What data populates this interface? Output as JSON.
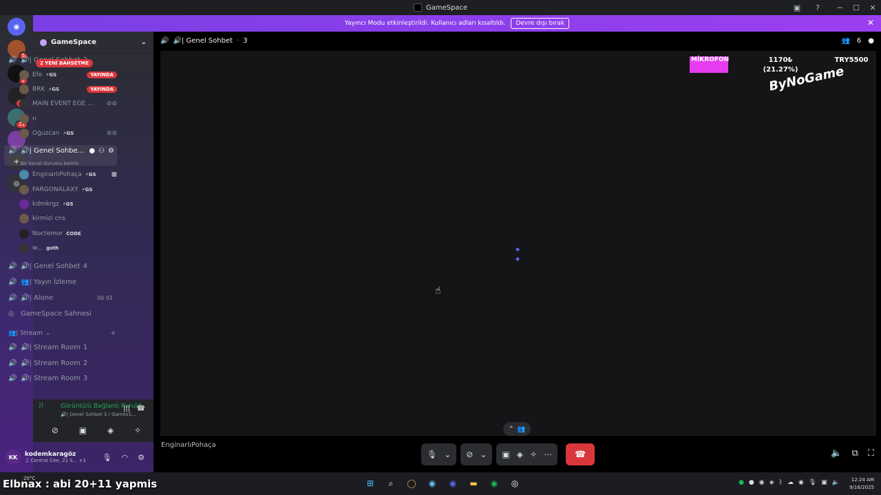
{
  "window": {
    "title": "GameSpace"
  },
  "banner": {
    "text": "Yayıncı Modu etkinleştirildi. Kullanıcı adları kısaltıldı.",
    "button": "Devre dışı bırak"
  },
  "guilds": {
    "badges": [
      "5",
      "2",
      "10",
      "21"
    ]
  },
  "server": {
    "name": "GameSpace"
  },
  "sidebar": {
    "mention_pill": "2 YENİ BAHSETME",
    "channel_top": {
      "label": "🔊| Genel Sohbet",
      "count": "2"
    },
    "members_top": [
      {
        "name": "Efe",
        "tag": "⚡GS",
        "live": "YAYINDA"
      },
      {
        "name": "BRK",
        "tag": "⚡GS",
        "live": "YAYINDA"
      },
      {
        "name": "MAIN EVENT EGE ...",
        "tag": "",
        "live": ""
      },
      {
        "name": "n",
        "tag": "",
        "live": ""
      },
      {
        "name": "Oğuzcan",
        "tag": "⚡GS",
        "live": ""
      }
    ],
    "active_channel": {
      "label": "🔊| Genel Sohbe...",
      "sub": "Bir kanal durumu belirle"
    },
    "members_active": [
      {
        "name": "EnginarlıPohaça",
        "tag": "⚡GS"
      },
      {
        "name": "FARGONALAXY",
        "tag": "⚡GS"
      },
      {
        "name": "kdmkrgz",
        "tag": "⚡GS"
      },
      {
        "name": "kirmizi cns",
        "tag": ""
      },
      {
        "name": "Noctemor",
        "tag": "CODE"
      },
      {
        "name": "w...",
        "tag": "goth"
      }
    ],
    "channels": [
      {
        "label": "🔊| Genel Sohbet",
        "count": "4"
      },
      {
        "label": "👥| Yayın İzleme",
        "count": ""
      },
      {
        "label": "🔊| Alone",
        "count": "00 01"
      },
      {
        "label": "GameSpace Sahnesi",
        "count": ""
      }
    ],
    "category": "👥| Stream",
    "stream_channels": [
      {
        "label": "🔊| Stream Room",
        "count": "1"
      },
      {
        "label": "🔊| Stream Room",
        "count": "2"
      },
      {
        "label": "🔊| Stream Room",
        "count": "3"
      }
    ]
  },
  "voice_panel": {
    "title": "Görüntülü Bağlantı Kuruld",
    "sub": "🔊| Genel Sohbet  3 / GamesS..."
  },
  "user": {
    "initials": "KK",
    "name": "kodemkaragöz",
    "status": "♫ Central Cee, 21 S...  +1"
  },
  "stage": {
    "title": "🔊| Genel Sohbet",
    "count": "3",
    "participants": "6",
    "name_tag": "EnginarlıPohaça"
  },
  "overlay": {
    "mic_label": "MİKROFON",
    "value1": "1170₺",
    "value1_pct": "(21.27%)",
    "value2": "TRY5500",
    "logo_text": "ByNoGame"
  },
  "taskbar": {
    "weather": "20°C",
    "overlay_text": "Elbnax : abi 20+11 yapmis",
    "time": "12:24 AM",
    "date": "9/16/2025"
  }
}
